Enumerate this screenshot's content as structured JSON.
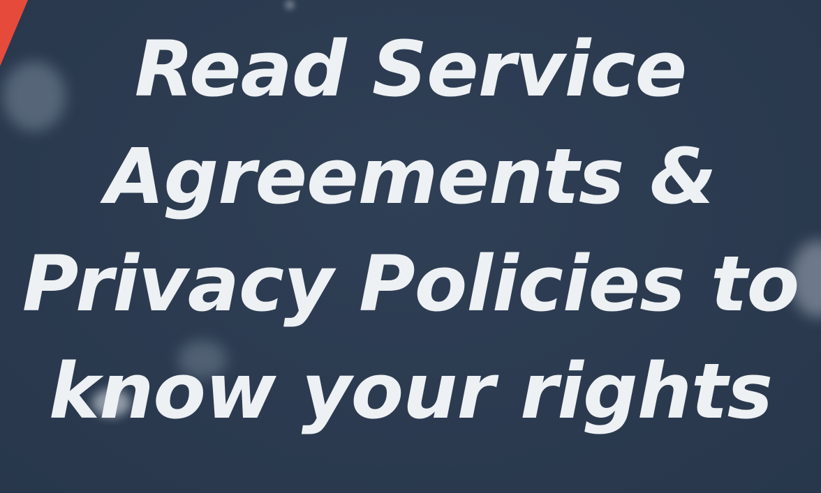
{
  "headline": {
    "lines": [
      "Read Service",
      "Agreements &",
      "Privacy Policies to",
      "know your rights"
    ]
  },
  "colors": {
    "background": "#2b3a4f",
    "text": "#eef1f4",
    "accent": "#e64a3b"
  }
}
